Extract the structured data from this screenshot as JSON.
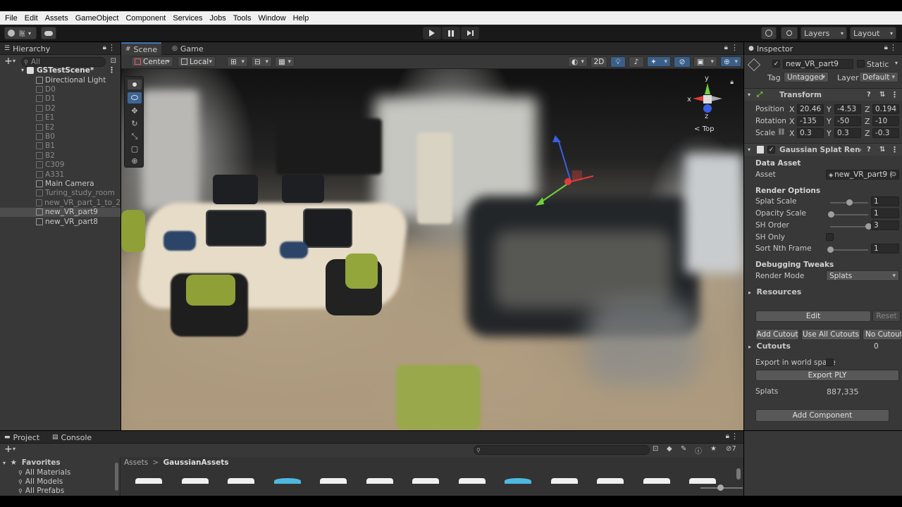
{
  "menu": [
    "File",
    "Edit",
    "Assets",
    "GameObject",
    "Component",
    "Services",
    "Jobs",
    "Tools",
    "Window",
    "Help"
  ],
  "toolbar": {
    "account_label": "账",
    "layers_label": "Layers",
    "layout_label": "Layout",
    "play_icon": "play-icon",
    "pause_icon": "pause-icon",
    "step_icon": "step-icon"
  },
  "hierarchy": {
    "tab_label": "Hierarchy",
    "search_placeholder": "All",
    "scene_name": "GSTestScene*",
    "items": [
      {
        "label": "Directional Light",
        "dim": false,
        "selected": false
      },
      {
        "label": "D0",
        "dim": true,
        "selected": false
      },
      {
        "label": "D1",
        "dim": true,
        "selected": false
      },
      {
        "label": "D2",
        "dim": true,
        "selected": false
      },
      {
        "label": "E1",
        "dim": true,
        "selected": false
      },
      {
        "label": "E2",
        "dim": true,
        "selected": false
      },
      {
        "label": "B0",
        "dim": true,
        "selected": false
      },
      {
        "label": "B1",
        "dim": true,
        "selected": false
      },
      {
        "label": "B2",
        "dim": true,
        "selected": false
      },
      {
        "label": "C309",
        "dim": true,
        "selected": false
      },
      {
        "label": "A331",
        "dim": true,
        "selected": false
      },
      {
        "label": "Main Camera",
        "dim": false,
        "selected": false
      },
      {
        "label": "Turing_study_room",
        "dim": true,
        "selected": false
      },
      {
        "label": "new_VR_part_1_to_2",
        "dim": true,
        "selected": false
      },
      {
        "label": "new_VR_part9",
        "dim": false,
        "selected": true
      },
      {
        "label": "new_VR_part8",
        "dim": false,
        "selected": false
      }
    ]
  },
  "scene": {
    "tabs": [
      {
        "label": "Scene"
      },
      {
        "label": "Game"
      }
    ],
    "pivot_label": "Center",
    "space_label": "Local",
    "mode_2d_label": "2D",
    "gizmo_view_label": "Top",
    "axis_y": "y",
    "axis_x": "x",
    "axis_z": "z"
  },
  "inspector": {
    "tab_label": "Inspector",
    "object_name": "new_VR_part9",
    "static_label": "Static",
    "tag_label": "Tag",
    "tag_value": "Untagged",
    "layer_label": "Layer",
    "layer_value": "Default",
    "transform": {
      "title": "Transform",
      "position_label": "Position",
      "rotation_label": "Rotation",
      "scale_label": "Scale",
      "pos": {
        "x": "20.46",
        "y": "-4.53",
        "z": "0.194"
      },
      "rot": {
        "x": "-135",
        "y": "-50",
        "z": "-10"
      },
      "scl": {
        "x": "0.3",
        "y": "0.3",
        "z": "-0.3"
      },
      "x_label": "X",
      "y_label": "Y",
      "z_label": "Z"
    },
    "splat": {
      "title": "Gaussian Splat Renderer",
      "data_asset_section": "Data Asset",
      "asset_label": "Asset",
      "asset_value": "new_VR_part9 (",
      "render_options_section": "Render Options",
      "splat_scale_label": "Splat Scale",
      "splat_scale_value": "1",
      "splat_scale_level": 0.5,
      "opacity_scale_label": "Opacity Scale",
      "opacity_scale_value": "1",
      "opacity_scale_level": 0.02,
      "sh_order_label": "SH Order",
      "sh_order_value": "3",
      "sh_order_level": 1.0,
      "sh_only_label": "SH Only",
      "sort_label": "Sort Nth Frame",
      "sort_value": "1",
      "sort_level": 0.0,
      "debug_section": "Debugging Tweaks",
      "render_mode_label": "Render Mode",
      "render_mode_value": "Splats",
      "resources_label": "Resources",
      "edit_label": "Edit",
      "reset_label": "Reset",
      "add_cutout_label": "Add Cutout",
      "use_all_cutouts_label": "Use All Cutouts",
      "no_cutouts_label": "No Cutouts",
      "cutouts_label": "Cutouts",
      "cutouts_value": "0",
      "export_world_label": "Export in world space",
      "export_ply_label": "Export PLY",
      "splats_label": "Splats",
      "splats_value": "887,335"
    },
    "add_component_label": "Add Component"
  },
  "project": {
    "tabs": [
      {
        "label": "Project"
      },
      {
        "label": "Console"
      }
    ],
    "favorites_label": "Favorites",
    "favorites": [
      "All Materials",
      "All Models",
      "All Prefabs"
    ],
    "breadcrumb_root": "Assets",
    "breadcrumb_sep": ">",
    "breadcrumb_folder": "GaussianAssets",
    "hidden_count": "7"
  },
  "colors": {
    "accent": "#3a79bb",
    "gizmo_red": "#e23a3a",
    "gizmo_green": "#6fd13a",
    "gizmo_blue": "#3a5fe2"
  }
}
